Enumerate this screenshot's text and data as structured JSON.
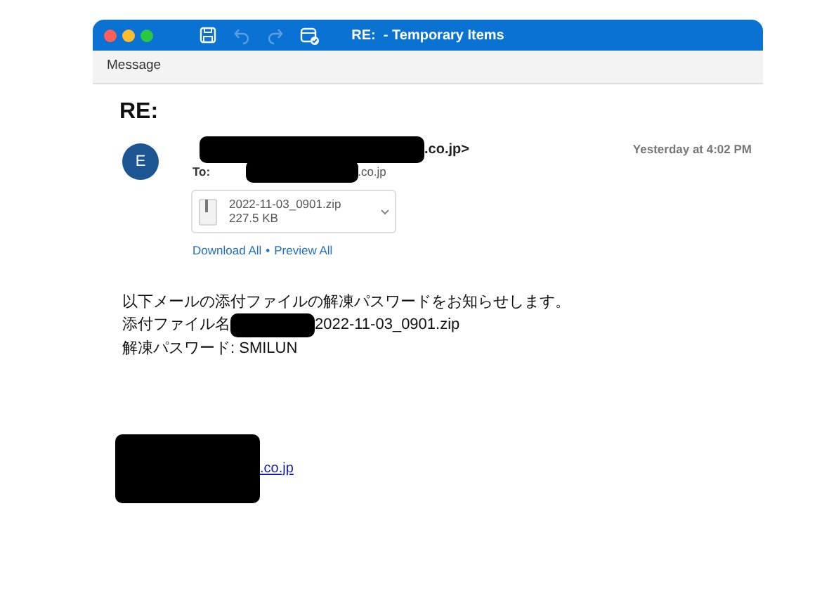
{
  "window": {
    "title": "RE:  - Temporary Items",
    "toolbar_tab": "Message",
    "toolbar_buttons": [
      {
        "kind": "save",
        "disabled": false
      },
      {
        "kind": "undo",
        "disabled": true
      },
      {
        "kind": "redo",
        "disabled": true
      },
      {
        "kind": "calendar",
        "disabled": false
      }
    ]
  },
  "message": {
    "subject": "RE:",
    "avatar_initial": "E",
    "date": "Yesterday at 4:02 PM",
    "from": [
      {
        "kind": "redaction"
      },
      {
        "kind": "text",
        "text": ".co.jp>"
      }
    ],
    "to_label": "To:",
    "to": [
      {
        "kind": "redaction"
      },
      {
        "kind": "text",
        "text": ".co.jp"
      }
    ],
    "attachment": {
      "name": "2022-11-03_0901.zip",
      "size": "227.5 KB"
    },
    "actions": [
      "Download All",
      "Preview All"
    ],
    "separator": "•",
    "body": [
      [
        {
          "kind": "text",
          "text": "以下メールの添付ファイルの解凍パスワードをお知らせします。"
        }
      ],
      [
        {
          "kind": "text",
          "text": "添付ファイル名"
        },
        {
          "kind": "redaction"
        },
        {
          "kind": "text",
          "text": "2022-11-03_0901.zip"
        }
      ],
      [
        {
          "kind": "text",
          "text": "解凍パスワード: SMILUN"
        }
      ]
    ],
    "signature": [
      {
        "kind": "redaction"
      },
      {
        "kind": "link",
        "text": ".co.jp"
      }
    ]
  }
}
